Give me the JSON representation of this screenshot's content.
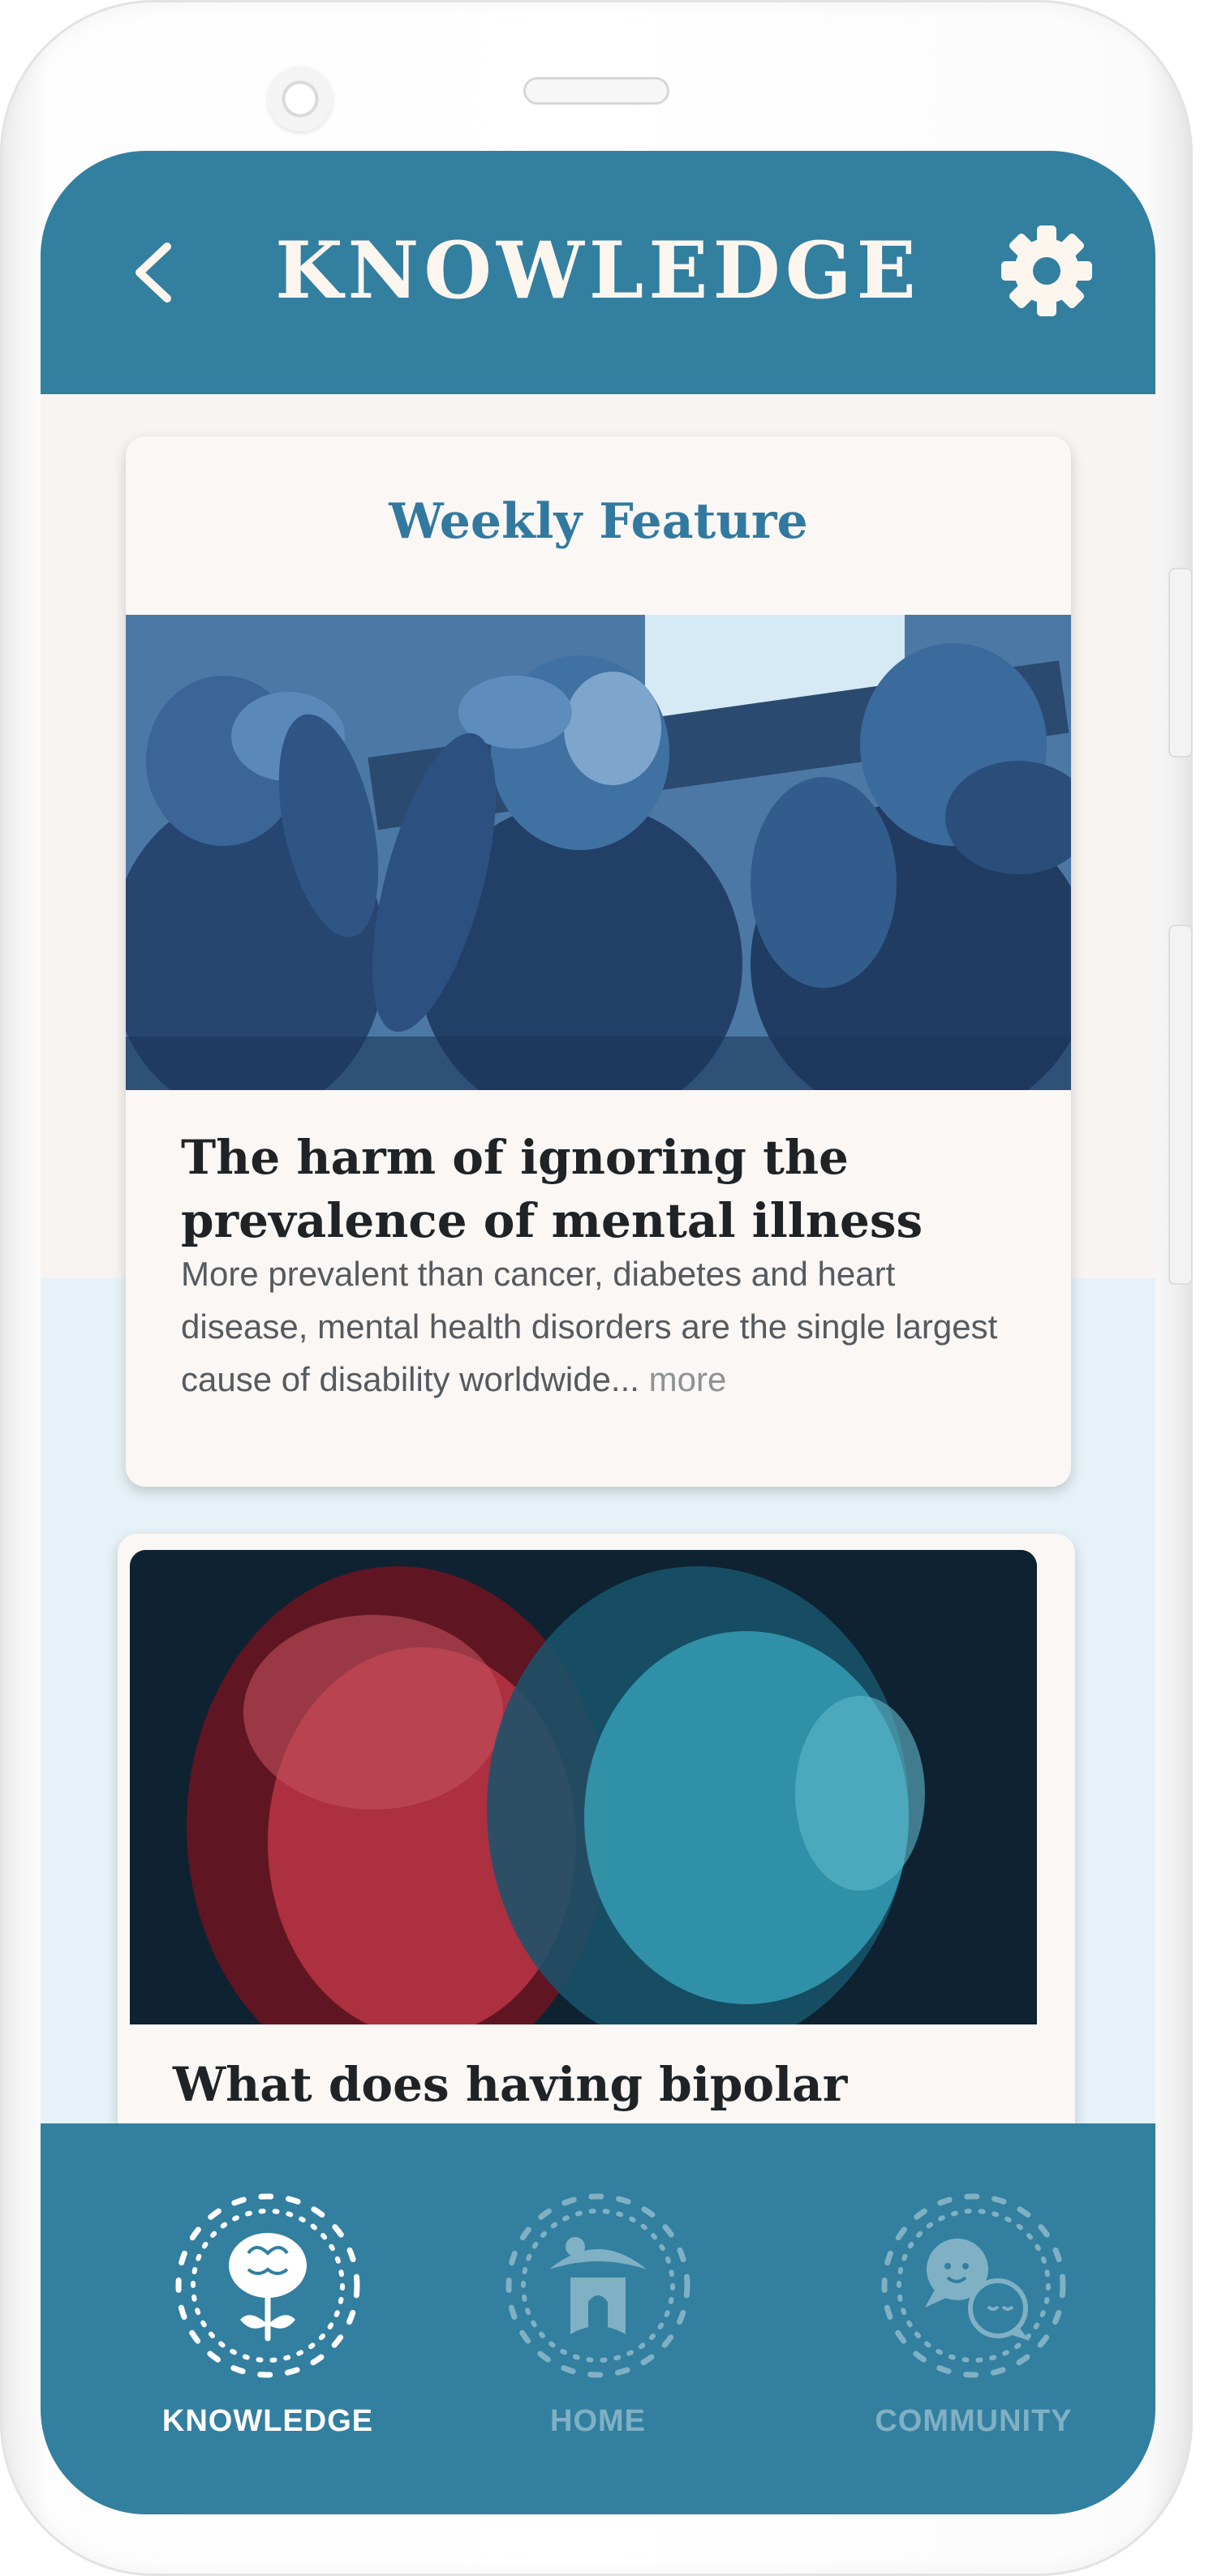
{
  "header": {
    "title": "KNOWLEDGE",
    "back_icon": "chevron-left-icon",
    "settings_icon": "gear-icon"
  },
  "feature_card": {
    "label": "Weekly Feature",
    "image": "three-monkeys-statue-photo",
    "title": "The harm of ignoring the prevalence of mental illness",
    "summary": "More prevalent than cancer, diabetes and heart disease, mental health disorders are the single largest cause of disability worldwide...",
    "more_label": "more"
  },
  "second_card": {
    "image": "blurred-red-blue-portrait-photo",
    "title": "What does having bipolar"
  },
  "bottom_nav": {
    "items": [
      {
        "label": "KNOWLEDGE",
        "icon": "brain-sun-icon",
        "active": true
      },
      {
        "label": "HOME",
        "icon": "home-sun-icon",
        "active": false
      },
      {
        "label": "COMMUNITY",
        "icon": "chat-faces-sun-icon",
        "active": false
      }
    ]
  },
  "colors": {
    "primary": "#327fa0",
    "header_text": "#fdf6ef",
    "card_background": "#faf7f5",
    "screen_background": "#f7f4f2",
    "light_band": "#e6f2f7"
  }
}
